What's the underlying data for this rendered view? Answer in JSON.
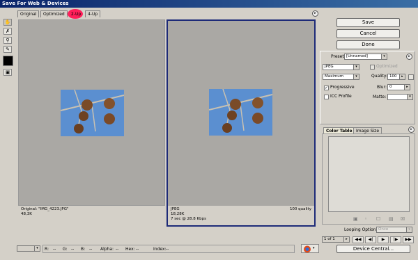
{
  "window": {
    "title": "Save For Web & Devices"
  },
  "view_tabs": [
    "Original",
    "Optimized",
    "2-Up",
    "4-Up"
  ],
  "active_tab": "2-Up",
  "highlight_color": "#ff1f5a",
  "tools": [
    "hand-tool-icon",
    "slice-select-tool-icon",
    "zoom-tool-icon",
    "eyedropper-tool-icon",
    "color-swatch",
    "toggle-slices-icon"
  ],
  "left_pane": {
    "line1": "Original: \"IMG_4223.JPG\"",
    "line2": "48,3K"
  },
  "right_pane": {
    "format": "JPEG",
    "size": "18,28K",
    "time": "7 sec @ 28.8 Kbps",
    "quality": "100 quality",
    "selected": true
  },
  "buttons": {
    "save": "Save",
    "cancel": "Cancel",
    "done": "Done"
  },
  "settings": {
    "preset_label": "Preset:",
    "preset_value": "[Unnamed]",
    "format_value": "JPEG",
    "quality_preset": "Maximum",
    "quality_label": "Quality:",
    "quality_value": "100",
    "optimized_label": "Optimized",
    "optimized_checked": false,
    "progressive_label": "Progressive",
    "progressive_checked": true,
    "blur_label": "Blur:",
    "blur_value": "0",
    "icc_label": "ICC Profile",
    "icc_checked": false,
    "matte_label": "Matte:",
    "matte_value": ""
  },
  "panel_tabs": [
    "Color Table",
    "Image Size"
  ],
  "active_panel_tab": "Color Table",
  "color_table_icons": [
    "map-color-icon",
    "web-shift-icon",
    "lock-color-icon",
    "new-color-icon",
    "delete-color-icon"
  ],
  "looping": {
    "label": "Looping Options:",
    "value": "Once"
  },
  "animation": {
    "frame_counter": "1 of 1",
    "nav": [
      "first-frame-icon",
      "previous-frame-icon",
      "play-icon",
      "next-frame-icon",
      "last-frame-icon"
    ]
  },
  "device_central_label": "Device Central...",
  "status_bar": {
    "zoom_value": "",
    "r": "R:",
    "r_val": "--",
    "g": "G:",
    "g_val": "--",
    "b": "B:",
    "b_val": "--",
    "alpha": "Alpha:",
    "alpha_val": "--",
    "hex": "Hex:",
    "hex_val": "--",
    "index": "Index:",
    "index_val": "--"
  }
}
